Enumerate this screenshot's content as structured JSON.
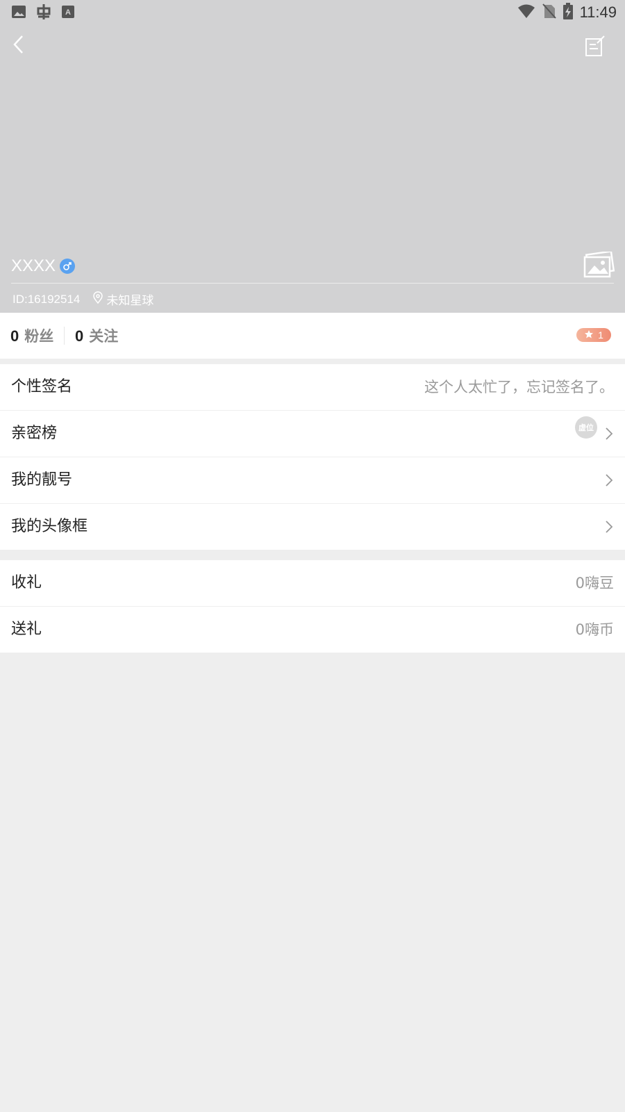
{
  "status_bar": {
    "time": "11:49",
    "left_icons": [
      "image-icon",
      "bug-icon",
      "text-icon"
    ],
    "right_icons": [
      "wifi-icon",
      "no-sim-icon",
      "battery-charging-icon"
    ]
  },
  "profile": {
    "name": "XXXX",
    "gender": "male",
    "id_text": "ID:16192514",
    "location": "未知星球"
  },
  "stats": {
    "fans_count": "0",
    "fans_label": "粉丝",
    "follow_count": "0",
    "follow_label": "关注",
    "level": "1"
  },
  "menu": {
    "signature_label": "个性签名",
    "signature_value": "这个人太忙了，忘记签名了。",
    "intimacy_label": "亲密榜",
    "intimacy_placeholder": "虚位",
    "number_label": "我的靓号",
    "frame_label": "我的头像框"
  },
  "gifts": {
    "received_label": "收礼",
    "received_value": "0嗨豆",
    "sent_label": "送礼",
    "sent_value": "0嗨币"
  },
  "colors": {
    "header_bg": "#d2d2d3",
    "page_bg": "#eeeeee",
    "gender_male": "#5aa2f0",
    "level_badge": "#ef8b73"
  }
}
